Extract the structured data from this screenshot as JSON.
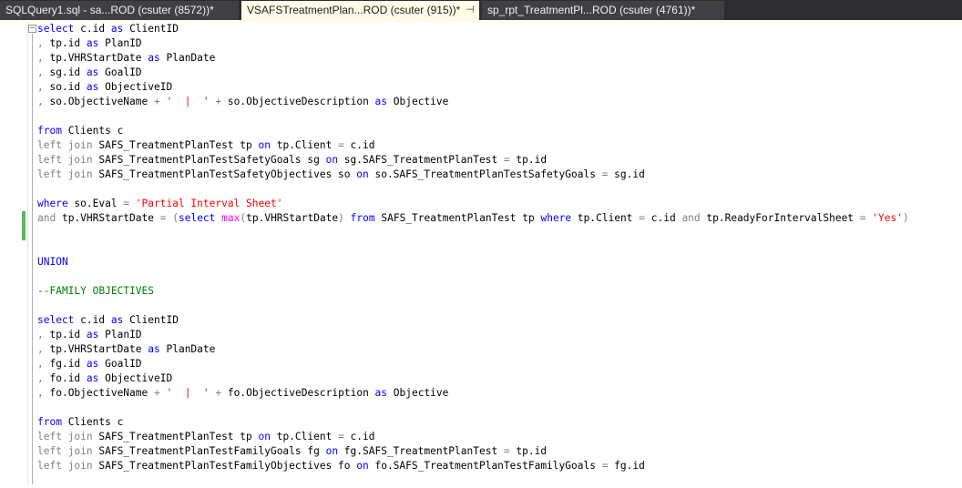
{
  "tabs": [
    {
      "label": "SQLQuery1.sql - sa...ROD (csuter (8572))*",
      "active": false
    },
    {
      "label": "VSAFSTreatmentPlan...ROD (csuter (915))*",
      "active": true
    },
    {
      "label": "sp_rpt_TreatmentPl...ROD (csuter (4761))*",
      "active": false
    }
  ],
  "colors": {
    "keyword": "#0000ff",
    "operator": "#808080",
    "function": "#ff00ff",
    "string": "#ff0000",
    "comment": "#008000",
    "change_bar": "#5cb85c"
  },
  "code_lines": [
    [
      {
        "t": "select",
        "c": "kw"
      },
      {
        "t": " c.id "
      },
      {
        "t": "as",
        "c": "kw"
      },
      {
        "t": " ClientID"
      }
    ],
    [
      {
        "t": ",",
        "c": "gray"
      },
      {
        "t": " tp.id "
      },
      {
        "t": "as",
        "c": "kw"
      },
      {
        "t": " PlanID"
      }
    ],
    [
      {
        "t": ",",
        "c": "gray"
      },
      {
        "t": " tp.VHRStartDate "
      },
      {
        "t": "as",
        "c": "kw"
      },
      {
        "t": " PlanDate"
      }
    ],
    [
      {
        "t": ",",
        "c": "gray"
      },
      {
        "t": " sg.id "
      },
      {
        "t": "as",
        "c": "kw"
      },
      {
        "t": " GoalID"
      }
    ],
    [
      {
        "t": ",",
        "c": "gray"
      },
      {
        "t": " so.id "
      },
      {
        "t": "as",
        "c": "kw"
      },
      {
        "t": " ObjectiveID"
      }
    ],
    [
      {
        "t": ",",
        "c": "gray"
      },
      {
        "t": " so.ObjectiveName "
      },
      {
        "t": "+",
        "c": "gray"
      },
      {
        "t": " "
      },
      {
        "t": "'  |  '",
        "c": "str"
      },
      {
        "t": " "
      },
      {
        "t": "+",
        "c": "gray"
      },
      {
        "t": " so.ObjectiveDescription "
      },
      {
        "t": "as",
        "c": "kw"
      },
      {
        "t": " Objective"
      }
    ],
    [],
    [
      {
        "t": "from",
        "c": "kw"
      },
      {
        "t": " Clients c"
      }
    ],
    [
      {
        "t": "left join",
        "c": "gray"
      },
      {
        "t": " SAFS_TreatmentPlanTest tp "
      },
      {
        "t": "on",
        "c": "kw"
      },
      {
        "t": " tp.Client "
      },
      {
        "t": "=",
        "c": "gray"
      },
      {
        "t": " c.id"
      }
    ],
    [
      {
        "t": "left join",
        "c": "gray"
      },
      {
        "t": " SAFS_TreatmentPlanTestSafetyGoals sg "
      },
      {
        "t": "on",
        "c": "kw"
      },
      {
        "t": " sg.SAFS_TreatmentPlanTest "
      },
      {
        "t": "=",
        "c": "gray"
      },
      {
        "t": " tp.id"
      }
    ],
    [
      {
        "t": "left join",
        "c": "gray"
      },
      {
        "t": " SAFS_TreatmentPlanTestSafetyObjectives so "
      },
      {
        "t": "on",
        "c": "kw"
      },
      {
        "t": " so.SAFS_TreatmentPlanTestSafetyGoals "
      },
      {
        "t": "=",
        "c": "gray"
      },
      {
        "t": " sg.id"
      }
    ],
    [],
    [
      {
        "t": "where",
        "c": "kw"
      },
      {
        "t": " so.Eval "
      },
      {
        "t": "=",
        "c": "gray"
      },
      {
        "t": " "
      },
      {
        "t": "'Partial Interval Sheet'",
        "c": "str"
      }
    ],
    [
      {
        "t": "and",
        "c": "gray"
      },
      {
        "t": " tp.VHRStartDate "
      },
      {
        "t": "=",
        "c": "gray"
      },
      {
        "t": " "
      },
      {
        "t": "(",
        "c": "gray"
      },
      {
        "t": "select",
        "c": "kw"
      },
      {
        "t": " "
      },
      {
        "t": "max",
        "c": "fn"
      },
      {
        "t": "(",
        "c": "gray"
      },
      {
        "t": "tp.VHRStartDate"
      },
      {
        "t": ")",
        "c": "gray"
      },
      {
        "t": " "
      },
      {
        "t": "from",
        "c": "kw"
      },
      {
        "t": " SAFS_TreatmentPlanTest tp "
      },
      {
        "t": "where",
        "c": "kw"
      },
      {
        "t": " tp.Client "
      },
      {
        "t": "=",
        "c": "gray"
      },
      {
        "t": " c.id "
      },
      {
        "t": "and",
        "c": "gray"
      },
      {
        "t": " tp.ReadyForIntervalSheet "
      },
      {
        "t": "=",
        "c": "gray"
      },
      {
        "t": " "
      },
      {
        "t": "'Yes'",
        "c": "str"
      },
      {
        "t": ")",
        "c": "gray"
      }
    ],
    [],
    [],
    [
      {
        "t": "UNION",
        "c": "kw"
      }
    ],
    [],
    [
      {
        "t": "--FAMILY OBJECTIVES",
        "c": "cmt"
      }
    ],
    [],
    [
      {
        "t": "select",
        "c": "kw"
      },
      {
        "t": " c.id "
      },
      {
        "t": "as",
        "c": "kw"
      },
      {
        "t": " ClientID"
      }
    ],
    [
      {
        "t": ",",
        "c": "gray"
      },
      {
        "t": " tp.id "
      },
      {
        "t": "as",
        "c": "kw"
      },
      {
        "t": " PlanID"
      }
    ],
    [
      {
        "t": ",",
        "c": "gray"
      },
      {
        "t": " tp.VHRStartDate "
      },
      {
        "t": "as",
        "c": "kw"
      },
      {
        "t": " PlanDate"
      }
    ],
    [
      {
        "t": ",",
        "c": "gray"
      },
      {
        "t": " fg.id "
      },
      {
        "t": "as",
        "c": "kw"
      },
      {
        "t": " GoalID"
      }
    ],
    [
      {
        "t": ",",
        "c": "gray"
      },
      {
        "t": " fo.id "
      },
      {
        "t": "as",
        "c": "kw"
      },
      {
        "t": " ObjectiveID"
      }
    ],
    [
      {
        "t": ",",
        "c": "gray"
      },
      {
        "t": " fo.ObjectiveName "
      },
      {
        "t": "+",
        "c": "gray"
      },
      {
        "t": " "
      },
      {
        "t": "'  |  '",
        "c": "str"
      },
      {
        "t": " "
      },
      {
        "t": "+",
        "c": "gray"
      },
      {
        "t": " fo.ObjectiveDescription "
      },
      {
        "t": "as",
        "c": "kw"
      },
      {
        "t": " Objective"
      }
    ],
    [],
    [
      {
        "t": "from",
        "c": "kw"
      },
      {
        "t": " Clients c"
      }
    ],
    [
      {
        "t": "left join",
        "c": "gray"
      },
      {
        "t": " SAFS_TreatmentPlanTest tp "
      },
      {
        "t": "on",
        "c": "kw"
      },
      {
        "t": " tp.Client "
      },
      {
        "t": "=",
        "c": "gray"
      },
      {
        "t": " c.id"
      }
    ],
    [
      {
        "t": "left join",
        "c": "gray"
      },
      {
        "t": " SAFS_TreatmentPlanTestFamilyGoals fg "
      },
      {
        "t": "on",
        "c": "kw"
      },
      {
        "t": " fg.SAFS_TreatmentPlanTest "
      },
      {
        "t": "=",
        "c": "gray"
      },
      {
        "t": " tp.id"
      }
    ],
    [
      {
        "t": "left join",
        "c": "gray"
      },
      {
        "t": " SAFS_TreatmentPlanTestFamilyObjectives fo "
      },
      {
        "t": "on",
        "c": "kw"
      },
      {
        "t": " fo.SAFS_TreatmentPlanTestFamilyGoals "
      },
      {
        "t": "=",
        "c": "gray"
      },
      {
        "t": " fg.id"
      }
    ],
    []
  ]
}
